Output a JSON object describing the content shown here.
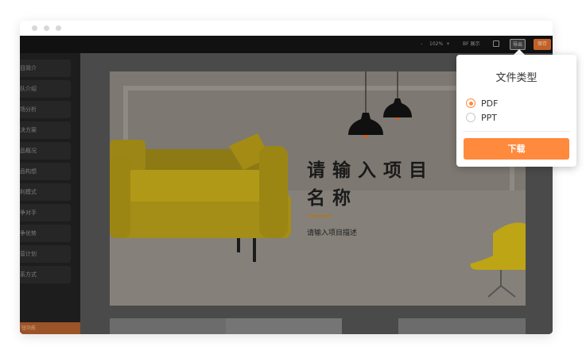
{
  "toolbar": {
    "zoom_out": "-",
    "zoom_level": "102%",
    "zoom_in": "+",
    "preview_label": "BF 展示",
    "download_label": "导出",
    "save_label": "保存"
  },
  "sidebar": {
    "items": [
      {
        "label": "目简介"
      },
      {
        "label": "队介绍"
      },
      {
        "label": "场分析"
      },
      {
        "label": "决方案"
      },
      {
        "label": "品概况"
      },
      {
        "label": "品构想"
      },
      {
        "label": "利模式"
      },
      {
        "label": "争对手"
      },
      {
        "label": "争优势"
      },
      {
        "label": "营计划"
      },
      {
        "label": "系方式"
      }
    ],
    "bottom_label": "  钮功能"
  },
  "slide": {
    "title_line1": "请输入项目",
    "title_line2": "名称",
    "description": "请输入项目描述"
  },
  "popup": {
    "title": "文件类型",
    "options": [
      {
        "label": "PDF",
        "checked": true
      },
      {
        "label": "PPT",
        "checked": false
      }
    ],
    "download_button": "下载"
  },
  "colors": {
    "accent": "#ff8a3d",
    "toolbar_bg": "#111111",
    "sidebar_bg": "#1d1d1d",
    "sofa": "#c9a816",
    "chair": "#d9c315"
  }
}
